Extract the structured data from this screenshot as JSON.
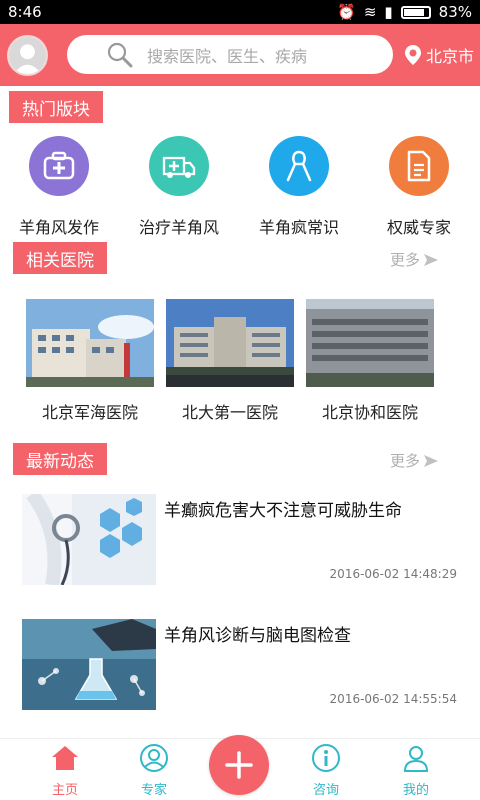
{
  "status_bar": {
    "time": "8:46",
    "battery": "83%"
  },
  "header": {
    "search_placeholder": "搜索医院、医生、疾病",
    "location": "北京市"
  },
  "sections": {
    "hot": {
      "title": "热门版块"
    },
    "hospitals": {
      "title": "相关医院",
      "more": "更多"
    },
    "news": {
      "title": "最新动态",
      "more": "更多"
    }
  },
  "hot_items": [
    {
      "label": "羊角风发作",
      "icon": "medical-kit-icon",
      "color": "#8b74d6"
    },
    {
      "label": "治疗羊角风",
      "icon": "ambulance-icon",
      "color": "#3cc7b4"
    },
    {
      "label": "羊角疯常识",
      "icon": "ribbon-icon",
      "color": "#1fa8ea"
    },
    {
      "label": "权威专家",
      "icon": "document-icon",
      "color": "#f07d3e"
    }
  ],
  "hospitals": [
    {
      "name": "北京军海医院"
    },
    {
      "name": "北大第一医院"
    },
    {
      "name": "北京协和医院"
    }
  ],
  "news": [
    {
      "title": "羊癫疯危害大不注意可威胁生命",
      "time": "2016-06-02 14:48:29"
    },
    {
      "title": "羊角风诊断与脑电图检查",
      "time": "2016-06-02 14:55:54"
    }
  ],
  "bottom_nav": {
    "home": "主页",
    "experts": "专家",
    "consult": "咨询",
    "mine": "我的"
  },
  "colors": {
    "accent": "#f5636a",
    "nav_active": "#f5636a",
    "nav_inactive": "#2fb8c8"
  }
}
